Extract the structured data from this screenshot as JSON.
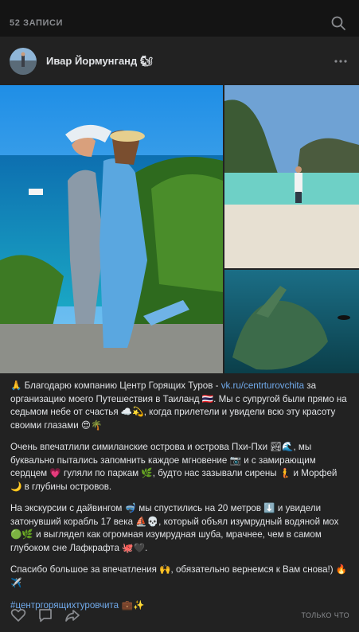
{
  "header": {
    "post_count": "52 ЗАПИСИ",
    "search_icon": "search-icon"
  },
  "post": {
    "author": "Ивар Йормунганд",
    "author_emoji": "🐿",
    "more_icon": "more-horizontal-icon",
    "paragraph1": {
      "lead_emoji": "🙏",
      "before_link": " Благодарю компанию Центр Горящих Туров - ",
      "link": "vk.ru/centrturovchita",
      "after_link": " за организацию моего Путешествия в Таиланд 🇹🇭. Мы с супругой были прямо на седьмом небе от счастья ☁️💫, когда прилетели и увидели всю эту красоту своими глазами 😍🌴"
    },
    "paragraph2": "Очень впечатлили симиланские острова и острова Пхи-Пхи 🏞🌊, мы буквально пытались запомнить каждое мгновение 📷 и с замирающим сердцем 💗 гуляли по паркам 🌿, будто нас зазывали сирены 🧜 и Морфей 🌙 в глубины островов.",
    "paragraph3": "На экскурсии с дайвингом 🤿 мы спустились на 20 метров ⬇️ и увидели затонувший корабль 17 века ⛵💀, который объял изумрудный водяной мох 🟢🌿 и выглядел как огромная изумрудная шуба, мрачнее, чем в самом глубоком сне Лафкрафта 🐙🖤.",
    "paragraph4": "Спасибо большое за впечатления 🙌, обязательно вернемся к Вам снова!) 🔥✈️",
    "hashtag": "#центргорящихтуровчита",
    "hashtag_emoji": " 💼✨",
    "timestamp": "ТОЛЬКО ЧТО",
    "actions": [
      "like-icon",
      "comment-icon",
      "share-icon"
    ]
  },
  "colors": {
    "background": "#141414",
    "card": "#222222",
    "link": "#71aaeb",
    "muted": "#8a8c90"
  }
}
